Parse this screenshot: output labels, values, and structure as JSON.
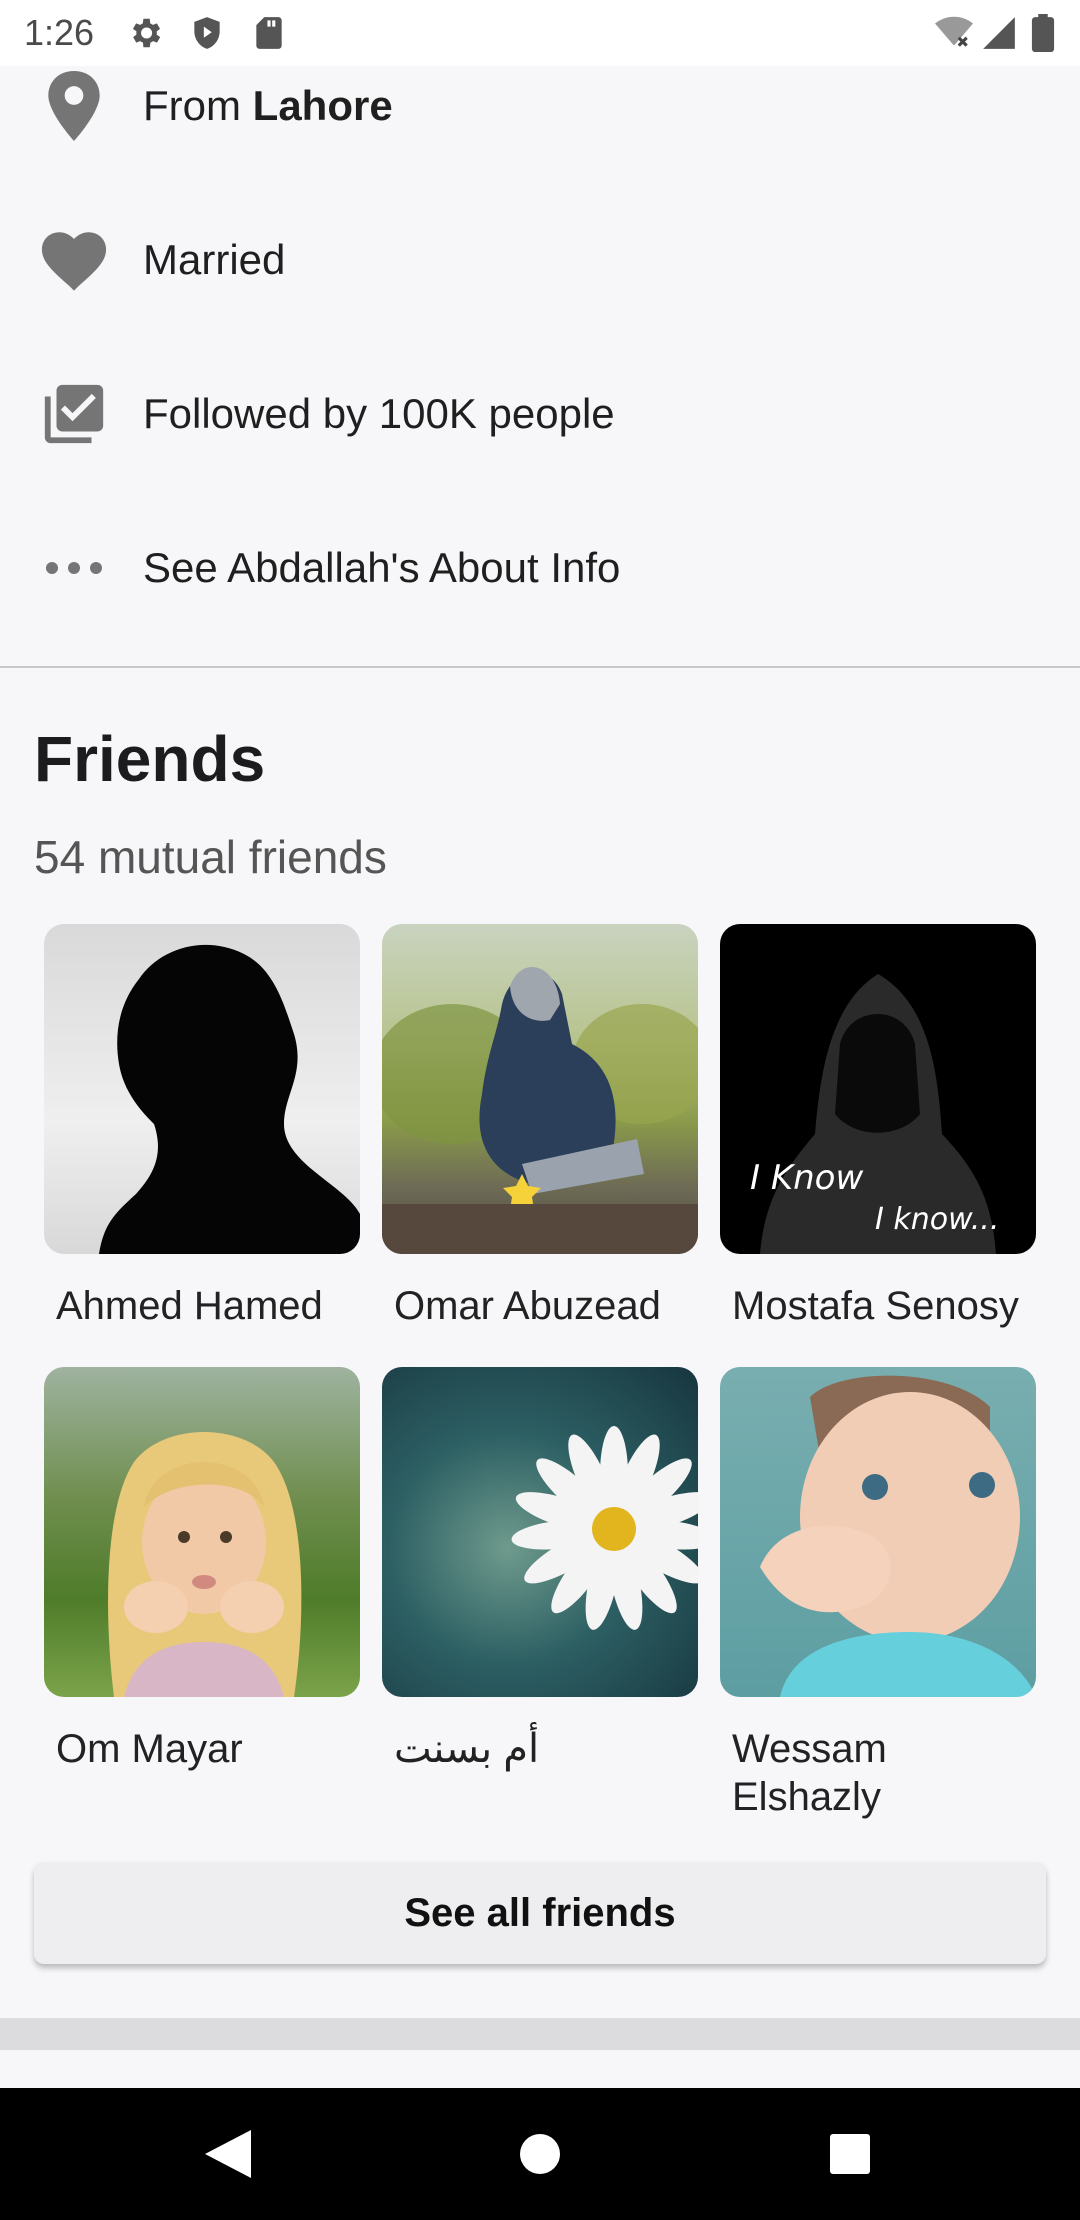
{
  "status_bar": {
    "time": "1:26",
    "left_icons": [
      "gear-icon",
      "shield-play-icon",
      "sd-card-icon"
    ],
    "right_icons": [
      "wifi-off-icon",
      "signal-icon",
      "battery-icon"
    ]
  },
  "info": {
    "from_prefix": "From",
    "from_city": "Lahore",
    "relationship": "Married",
    "followed": "Followed by 100K people",
    "about": "See Abdallah's About Info"
  },
  "friends": {
    "title": "Friends",
    "subtitle": "54 mutual friends",
    "items": [
      {
        "name": "Ahmed Hamed"
      },
      {
        "name": "Omar Abuzead"
      },
      {
        "name": "Mostafa Senosy"
      },
      {
        "name": "Om Mayar"
      },
      {
        "name": "أم بسنت"
      },
      {
        "name": "Wessam Elshazly"
      }
    ],
    "photo3_caption_line1": "I Know",
    "photo3_caption_line2": "I know...",
    "see_all_label": "See all friends"
  },
  "colors": {
    "background": "#f7f7f9",
    "icon_gray": "#757575",
    "button_bg": "#eeeef0"
  }
}
